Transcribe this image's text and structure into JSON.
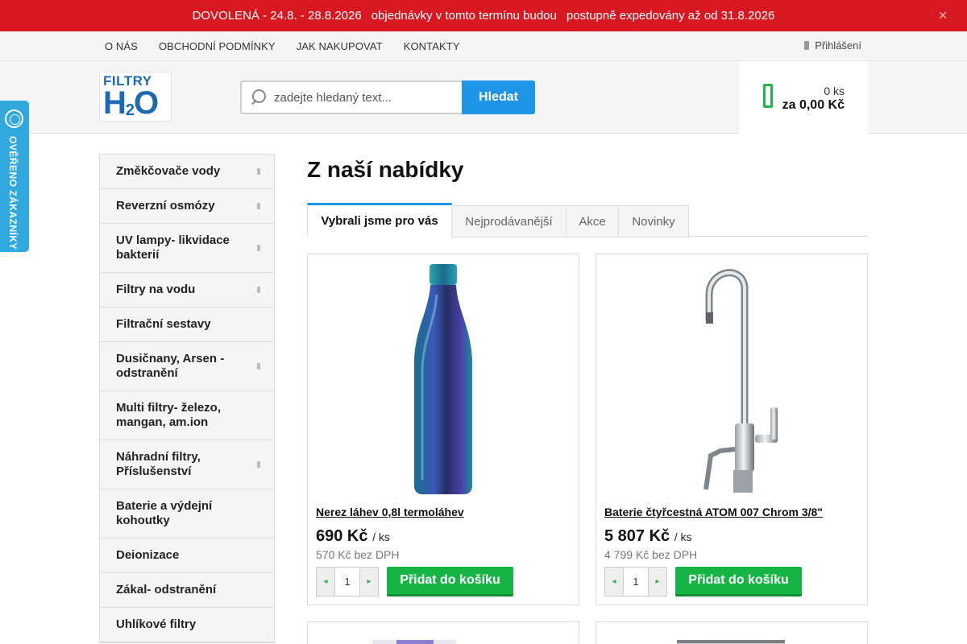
{
  "notice": {
    "part1": "DOVOLENÁ - 24.8. - 28.8.2026",
    "part2": "objednávky v tomto termínu budou",
    "part3": "postupně expedovány až od 31.8.2026",
    "close_icon": "close-icon"
  },
  "topnav": {
    "links": [
      "O NÁS",
      "OBCHODNÍ PODMÍNKY",
      "JAK NAKUPOVAT",
      "KONTAKTY"
    ],
    "login": "Přihlášení"
  },
  "header": {
    "logo_top": "FILTRY",
    "logo_h": "H",
    "logo_sub": "2",
    "logo_o": "O",
    "search_placeholder": "zadejte hledaný text...",
    "search_button": "Hledat",
    "cart_qty": "0 ks",
    "cart_total": "za 0,00 Kč"
  },
  "badge": {
    "text": "OVĚŘENO ZÁKAZNÍKY"
  },
  "sidebar": {
    "items": [
      {
        "label": "Změkčovače vody",
        "has_arrow": true
      },
      {
        "label": "Reverzní osmózy",
        "has_arrow": true
      },
      {
        "label": "UV lampy- likvidace bakterií",
        "has_arrow": true
      },
      {
        "label": "Filtry na vodu",
        "has_arrow": true
      },
      {
        "label": "Filtrační sestavy",
        "has_arrow": false
      },
      {
        "label": "Dusičnany, Arsen - odstranění",
        "has_arrow": true
      },
      {
        "label": "Multi filtry- železo, mangan, am.ion",
        "has_arrow": false
      },
      {
        "label": "Náhradní filtry, Příslušenství",
        "has_arrow": true
      },
      {
        "label": "Baterie a výdejní kohoutky",
        "has_arrow": false
      },
      {
        "label": "Deionizace",
        "has_arrow": false
      },
      {
        "label": "Zákal- odstranění",
        "has_arrow": false
      },
      {
        "label": "Uhlíkové filtry",
        "has_arrow": false
      }
    ]
  },
  "main": {
    "title": "Z naší nabídky",
    "tabs": [
      {
        "label": "Vybrali jsme pro vás",
        "active": true
      },
      {
        "label": "Nejprodávanější",
        "active": false
      },
      {
        "label": "Akce",
        "active": false
      },
      {
        "label": "Novinky",
        "active": false
      }
    ],
    "products": [
      {
        "name": "Nerez láhev 0,8l termoláhev",
        "price": "690 Kč",
        "unit": "/ ks",
        "price_novat": "570 Kč bez DPH",
        "qty": "1",
        "add_button": "Přidat do košíku"
      },
      {
        "name": "Baterie čtyřcestná ATOM 007 Chrom 3/8\"",
        "price": "5 807 Kč",
        "unit": "/ ks",
        "price_novat": "4 799 Kč bez DPH",
        "qty": "1",
        "add_button": "Přidat do košíku"
      }
    ]
  }
}
